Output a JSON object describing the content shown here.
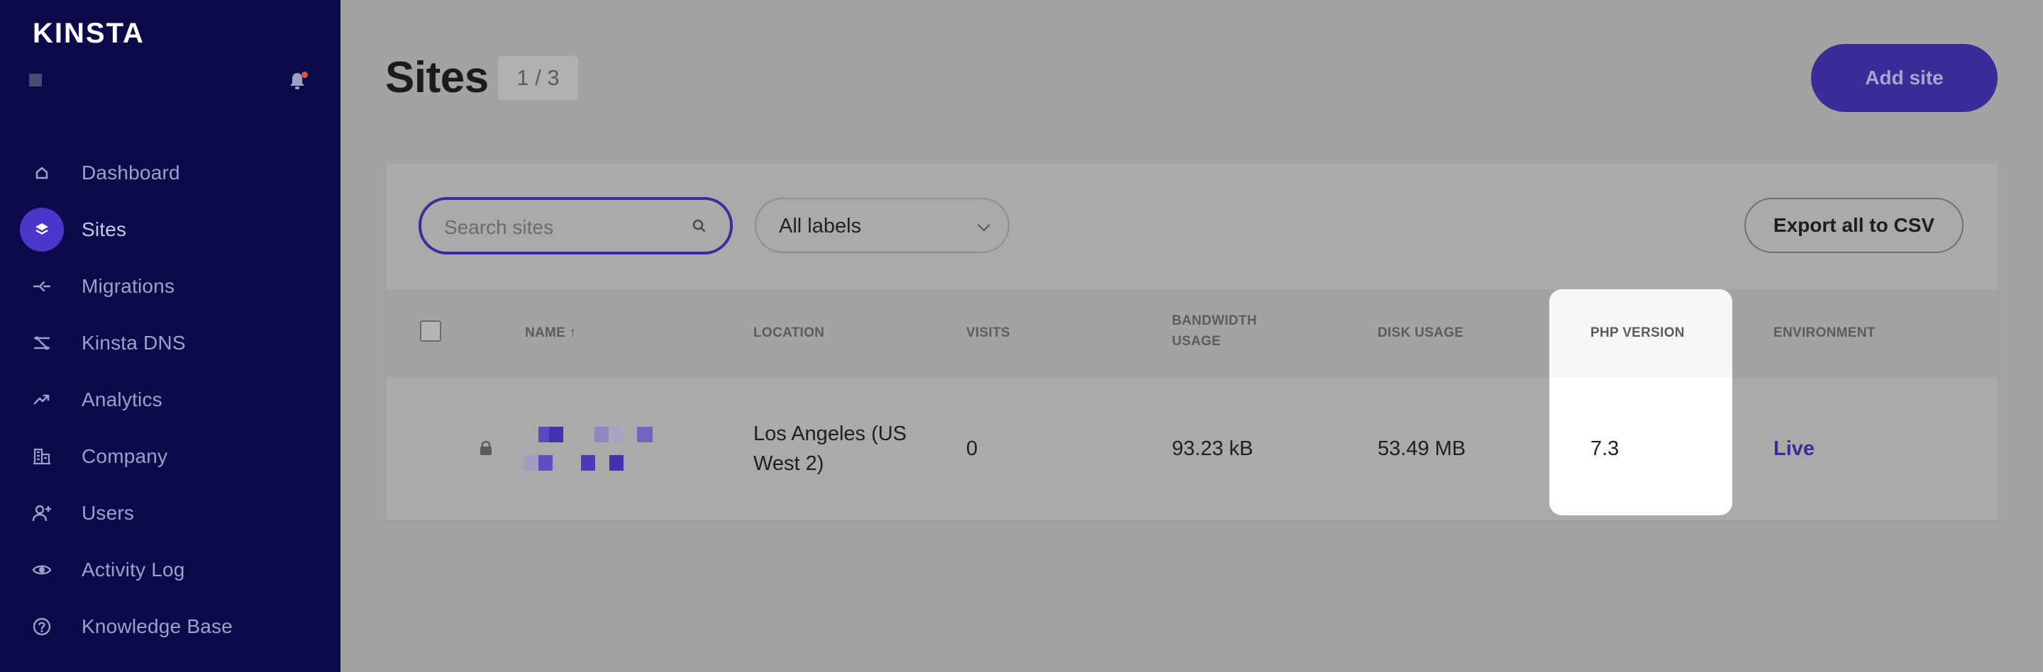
{
  "sidebar": {
    "brand": "KINSTA",
    "nav": [
      {
        "label": "Dashboard",
        "icon": "home-icon"
      },
      {
        "label": "Sites",
        "icon": "layers-icon",
        "active": true
      },
      {
        "label": "Migrations",
        "icon": "migration-icon"
      },
      {
        "label": "Kinsta DNS",
        "icon": "dns-icon"
      },
      {
        "label": "Analytics",
        "icon": "trend-icon"
      },
      {
        "label": "Company",
        "icon": "building-icon"
      },
      {
        "label": "Users",
        "icon": "add-user-icon"
      },
      {
        "label": "Activity Log",
        "icon": "eye-icon"
      },
      {
        "label": "Knowledge Base",
        "icon": "help-icon"
      }
    ]
  },
  "header": {
    "title": "Sites",
    "count": "1 / 3",
    "add_site_label": "Add site"
  },
  "toolbar": {
    "search_placeholder": "Search sites",
    "labels_selected": "All labels",
    "export_label": "Export all to CSV"
  },
  "table": {
    "columns": {
      "name": "NAME ↑",
      "location": "LOCATION",
      "visits": "VISITS",
      "bandwidth_line1": "BANDWIDTH",
      "bandwidth_line2": "USAGE",
      "disk": "DISK USAGE",
      "php": "PHP VERSION",
      "environment": "ENVIRONMENT"
    },
    "rows": [
      {
        "location_line1": "Los Angeles (US",
        "location_line2": "West 2)",
        "visits": "0",
        "bandwidth": "93.23 kB",
        "disk": "53.49 MB",
        "php": "7.3",
        "environment": "Live"
      }
    ]
  },
  "colors": {
    "sidebar_bg": "#0b0a4a",
    "accent": "#3a2d99",
    "highlight": "#ffffff"
  }
}
